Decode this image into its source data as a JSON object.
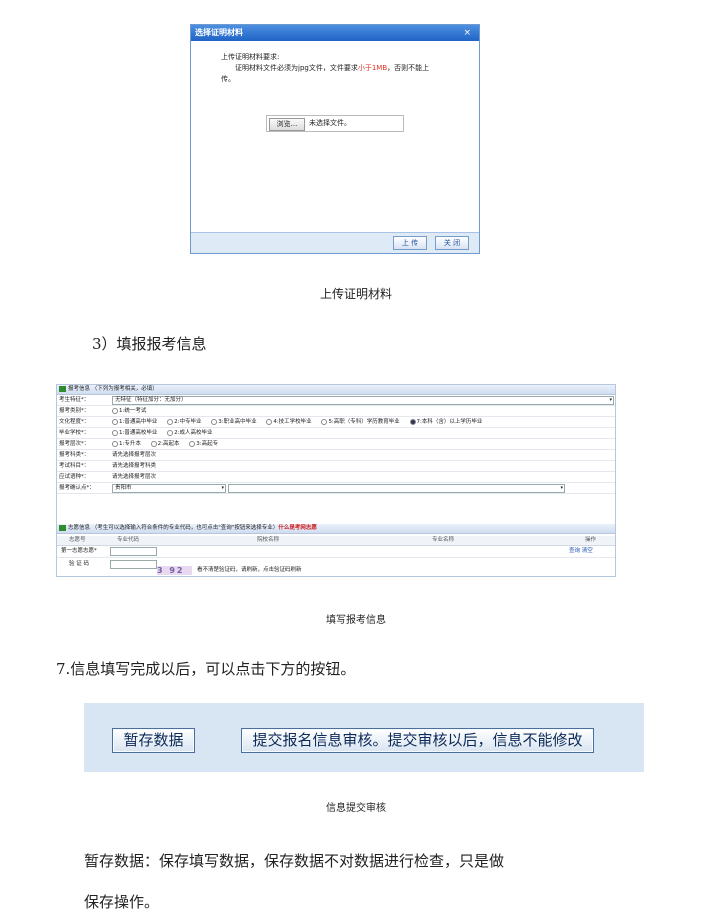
{
  "upload_dialog": {
    "title": "选择证明材料",
    "close_symbol": "×",
    "req_line1": "上传证明材料要求:",
    "req_line2_pre": "证明材料文件必须为jpg文件，文件要求",
    "req_line2_red": "小于1MB",
    "req_line2_post": "，否则不能上",
    "req_line3": "传。",
    "browse_label": "浏览...",
    "no_file_text": "未选择文件。",
    "upload_button": "上 传",
    "close_button": "关 闭"
  },
  "caption_upload": "上传证明材料",
  "heading_step3": "3）填报报考信息",
  "form": {
    "section1_title": "报考信息 （下列为报考相关，必填）",
    "rows": [
      {
        "label": "考生特征*：",
        "value": "无特征（特征加分：无加分）"
      },
      {
        "label": "报考类别*：",
        "options": [
          "1:统一考试"
        ]
      },
      {
        "label": "文化程度*：",
        "options": [
          "1:普通高中毕业",
          "2:中专毕业",
          "3:职业高中毕业",
          "4:技工学校毕业",
          "5:高职（专科）学历教育毕业",
          "7:本科（含）以上学历毕业"
        ],
        "selected_index": 5
      },
      {
        "label": "毕业学校*：",
        "options": [
          "1:普通高校毕业",
          "2:成人高校毕业"
        ]
      },
      {
        "label": "报考层次*：",
        "options": [
          "1:专升本",
          "2:高起本",
          "3:高起专"
        ]
      },
      {
        "label": "报考科类*：",
        "value": "请先选择报考层次"
      },
      {
        "label": "考试科目*：",
        "value": "请先选择报考科类"
      },
      {
        "label": "应试语种*：",
        "value": "请先选择报考层次"
      },
      {
        "label": "报考确认点*：",
        "value": "贵阳市"
      }
    ],
    "section2_title": "志愿信息 （考生可以选择输入符合条件的专业代码，也可点击\"查询\"按钮来选择专业）",
    "section2_red": "什么是考网志愿",
    "table_headers": [
      "志愿号",
      "专业代码",
      "院校名称",
      "专业名称",
      "操作"
    ],
    "row_label": "第一志愿志愿*",
    "row_action": "查询 清空",
    "captcha_label": "验 证 码",
    "captcha_text": "3 92",
    "captcha_hint": "看不清楚验证码，请刷新，点击验证码刷新"
  },
  "caption_form": "填写报考信息",
  "heading_7": "7.信息填写完成以后，可以点击下方的按钮。",
  "buttons": {
    "save_temp": "暂存数据",
    "submit": "提交报名信息审核。提交审核以后，信息不能修改"
  },
  "caption_submit": "信息提交审核",
  "para_line1": "暂存数据：保存填写数据，保存数据不对数据进行检查，只是做",
  "para_line2": "保存操作。"
}
